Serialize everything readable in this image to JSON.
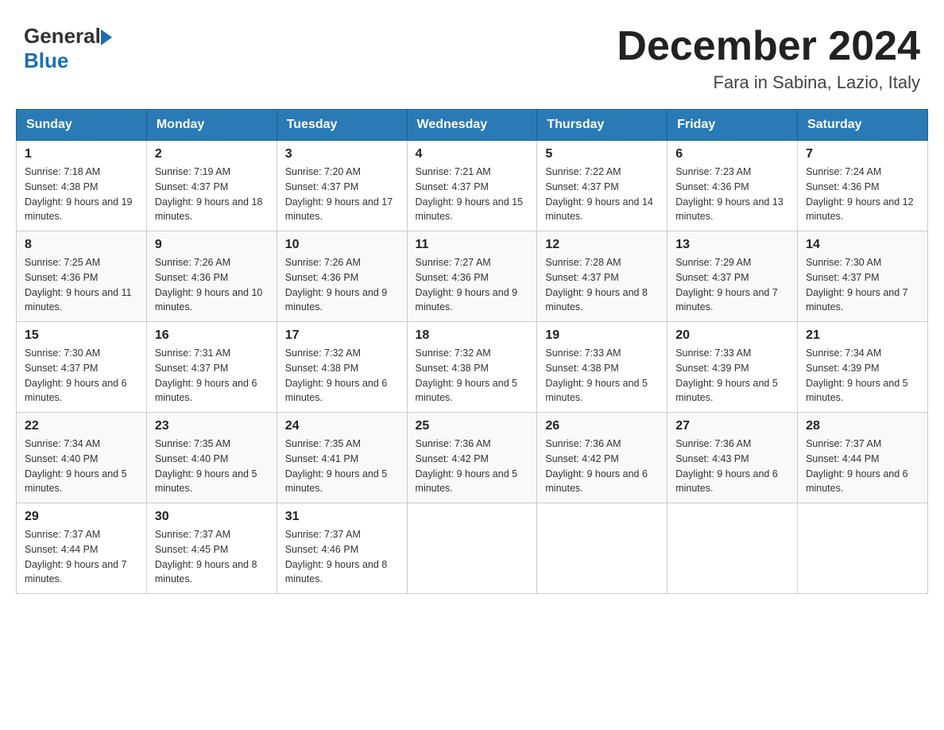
{
  "header": {
    "logo_general": "General",
    "logo_blue": "Blue",
    "title": "December 2024",
    "subtitle": "Fara in Sabina, Lazio, Italy"
  },
  "calendar": {
    "days_of_week": [
      "Sunday",
      "Monday",
      "Tuesday",
      "Wednesday",
      "Thursday",
      "Friday",
      "Saturday"
    ],
    "weeks": [
      [
        {
          "day": "1",
          "sunrise": "Sunrise: 7:18 AM",
          "sunset": "Sunset: 4:38 PM",
          "daylight": "Daylight: 9 hours and 19 minutes."
        },
        {
          "day": "2",
          "sunrise": "Sunrise: 7:19 AM",
          "sunset": "Sunset: 4:37 PM",
          "daylight": "Daylight: 9 hours and 18 minutes."
        },
        {
          "day": "3",
          "sunrise": "Sunrise: 7:20 AM",
          "sunset": "Sunset: 4:37 PM",
          "daylight": "Daylight: 9 hours and 17 minutes."
        },
        {
          "day": "4",
          "sunrise": "Sunrise: 7:21 AM",
          "sunset": "Sunset: 4:37 PM",
          "daylight": "Daylight: 9 hours and 15 minutes."
        },
        {
          "day": "5",
          "sunrise": "Sunrise: 7:22 AM",
          "sunset": "Sunset: 4:37 PM",
          "daylight": "Daylight: 9 hours and 14 minutes."
        },
        {
          "day": "6",
          "sunrise": "Sunrise: 7:23 AM",
          "sunset": "Sunset: 4:36 PM",
          "daylight": "Daylight: 9 hours and 13 minutes."
        },
        {
          "day": "7",
          "sunrise": "Sunrise: 7:24 AM",
          "sunset": "Sunset: 4:36 PM",
          "daylight": "Daylight: 9 hours and 12 minutes."
        }
      ],
      [
        {
          "day": "8",
          "sunrise": "Sunrise: 7:25 AM",
          "sunset": "Sunset: 4:36 PM",
          "daylight": "Daylight: 9 hours and 11 minutes."
        },
        {
          "day": "9",
          "sunrise": "Sunrise: 7:26 AM",
          "sunset": "Sunset: 4:36 PM",
          "daylight": "Daylight: 9 hours and 10 minutes."
        },
        {
          "day": "10",
          "sunrise": "Sunrise: 7:26 AM",
          "sunset": "Sunset: 4:36 PM",
          "daylight": "Daylight: 9 hours and 9 minutes."
        },
        {
          "day": "11",
          "sunrise": "Sunrise: 7:27 AM",
          "sunset": "Sunset: 4:36 PM",
          "daylight": "Daylight: 9 hours and 9 minutes."
        },
        {
          "day": "12",
          "sunrise": "Sunrise: 7:28 AM",
          "sunset": "Sunset: 4:37 PM",
          "daylight": "Daylight: 9 hours and 8 minutes."
        },
        {
          "day": "13",
          "sunrise": "Sunrise: 7:29 AM",
          "sunset": "Sunset: 4:37 PM",
          "daylight": "Daylight: 9 hours and 7 minutes."
        },
        {
          "day": "14",
          "sunrise": "Sunrise: 7:30 AM",
          "sunset": "Sunset: 4:37 PM",
          "daylight": "Daylight: 9 hours and 7 minutes."
        }
      ],
      [
        {
          "day": "15",
          "sunrise": "Sunrise: 7:30 AM",
          "sunset": "Sunset: 4:37 PM",
          "daylight": "Daylight: 9 hours and 6 minutes."
        },
        {
          "day": "16",
          "sunrise": "Sunrise: 7:31 AM",
          "sunset": "Sunset: 4:37 PM",
          "daylight": "Daylight: 9 hours and 6 minutes."
        },
        {
          "day": "17",
          "sunrise": "Sunrise: 7:32 AM",
          "sunset": "Sunset: 4:38 PM",
          "daylight": "Daylight: 9 hours and 6 minutes."
        },
        {
          "day": "18",
          "sunrise": "Sunrise: 7:32 AM",
          "sunset": "Sunset: 4:38 PM",
          "daylight": "Daylight: 9 hours and 5 minutes."
        },
        {
          "day": "19",
          "sunrise": "Sunrise: 7:33 AM",
          "sunset": "Sunset: 4:38 PM",
          "daylight": "Daylight: 9 hours and 5 minutes."
        },
        {
          "day": "20",
          "sunrise": "Sunrise: 7:33 AM",
          "sunset": "Sunset: 4:39 PM",
          "daylight": "Daylight: 9 hours and 5 minutes."
        },
        {
          "day": "21",
          "sunrise": "Sunrise: 7:34 AM",
          "sunset": "Sunset: 4:39 PM",
          "daylight": "Daylight: 9 hours and 5 minutes."
        }
      ],
      [
        {
          "day": "22",
          "sunrise": "Sunrise: 7:34 AM",
          "sunset": "Sunset: 4:40 PM",
          "daylight": "Daylight: 9 hours and 5 minutes."
        },
        {
          "day": "23",
          "sunrise": "Sunrise: 7:35 AM",
          "sunset": "Sunset: 4:40 PM",
          "daylight": "Daylight: 9 hours and 5 minutes."
        },
        {
          "day": "24",
          "sunrise": "Sunrise: 7:35 AM",
          "sunset": "Sunset: 4:41 PM",
          "daylight": "Daylight: 9 hours and 5 minutes."
        },
        {
          "day": "25",
          "sunrise": "Sunrise: 7:36 AM",
          "sunset": "Sunset: 4:42 PM",
          "daylight": "Daylight: 9 hours and 5 minutes."
        },
        {
          "day": "26",
          "sunrise": "Sunrise: 7:36 AM",
          "sunset": "Sunset: 4:42 PM",
          "daylight": "Daylight: 9 hours and 6 minutes."
        },
        {
          "day": "27",
          "sunrise": "Sunrise: 7:36 AM",
          "sunset": "Sunset: 4:43 PM",
          "daylight": "Daylight: 9 hours and 6 minutes."
        },
        {
          "day": "28",
          "sunrise": "Sunrise: 7:37 AM",
          "sunset": "Sunset: 4:44 PM",
          "daylight": "Daylight: 9 hours and 6 minutes."
        }
      ],
      [
        {
          "day": "29",
          "sunrise": "Sunrise: 7:37 AM",
          "sunset": "Sunset: 4:44 PM",
          "daylight": "Daylight: 9 hours and 7 minutes."
        },
        {
          "day": "30",
          "sunrise": "Sunrise: 7:37 AM",
          "sunset": "Sunset: 4:45 PM",
          "daylight": "Daylight: 9 hours and 8 minutes."
        },
        {
          "day": "31",
          "sunrise": "Sunrise: 7:37 AM",
          "sunset": "Sunset: 4:46 PM",
          "daylight": "Daylight: 9 hours and 8 minutes."
        },
        null,
        null,
        null,
        null
      ]
    ]
  }
}
